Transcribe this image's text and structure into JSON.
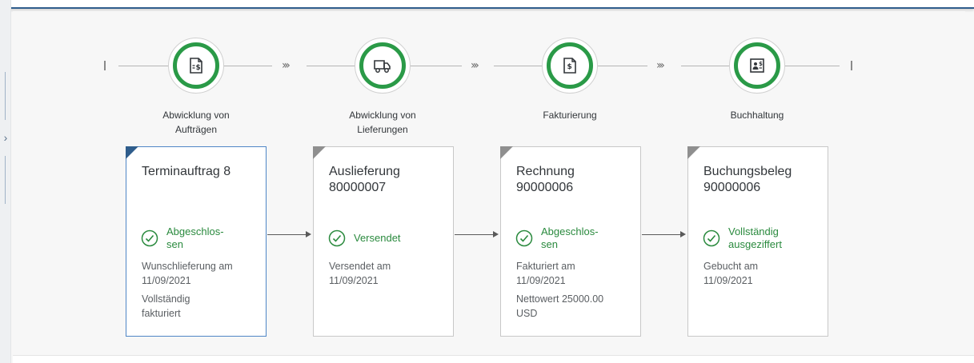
{
  "flow": {
    "steps": [
      {
        "label": "Abwicklung von\nAufträgen",
        "icon": "sales-order-document-icon"
      },
      {
        "label": "Abwicklung von\nLieferungen",
        "icon": "delivery-truck-icon"
      },
      {
        "label": "Fakturierung",
        "icon": "invoice-document-icon"
      },
      {
        "label": "Buchhaltung",
        "icon": "accounting-document-icon"
      }
    ],
    "status_color": "#2a9a47"
  },
  "cards": [
    {
      "title": "Terminauftrag 8",
      "status": "Abgeschlos-\nsen",
      "details": [
        "Wunschlieferung am\n11/09/2021",
        "Vollständig\nfakturiert"
      ]
    },
    {
      "title": "Auslieferung\n80000007",
      "status": "Versendet",
      "details": [
        "Versendet am\n11/09/2021"
      ]
    },
    {
      "title": "Rechnung\n90000006",
      "status": "Abgeschlos-\nsen",
      "details": [
        "Fakturiert am\n11/09/2021",
        "Nettowert 25000.00\nUSD"
      ]
    },
    {
      "title": "Buchungsbeleg\n90000006",
      "status": "Vollständig\nausgeziffert",
      "details": [
        "Gebucht am\n11/09/2021"
      ]
    }
  ]
}
